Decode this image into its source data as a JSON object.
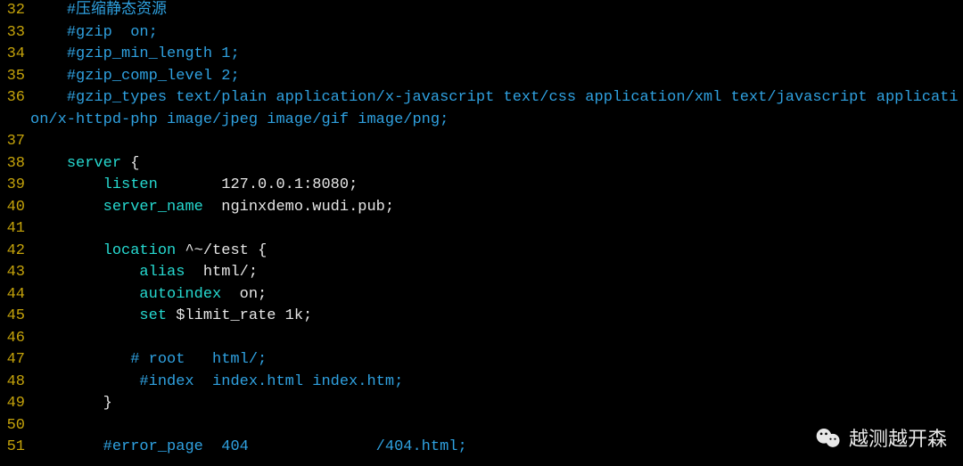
{
  "colors": {
    "bg": "#000000",
    "gutter": "#c5a30a",
    "comment": "#2fa1e0",
    "keyword": "#26d9d0",
    "text": "#e6e6e6"
  },
  "watermark": {
    "text": "越测越开森"
  },
  "lines": [
    {
      "num": 32,
      "indent": "    ",
      "segments": [
        {
          "cls": "c-comment",
          "t": "#压缩静态资源"
        }
      ]
    },
    {
      "num": 33,
      "indent": "    ",
      "segments": [
        {
          "cls": "c-comment",
          "t": "#gzip  on;"
        }
      ]
    },
    {
      "num": 34,
      "indent": "    ",
      "segments": [
        {
          "cls": "c-comment",
          "t": "#gzip_min_length 1;"
        }
      ]
    },
    {
      "num": 35,
      "indent": "    ",
      "segments": [
        {
          "cls": "c-comment",
          "t": "#gzip_comp_level 2;"
        }
      ]
    },
    {
      "num": 36,
      "indent": "    ",
      "segments": [
        {
          "cls": "c-comment",
          "t": "#gzip_types text/plain application/x-javascript text/css application/xml text/javascript application/x-httpd-php image/jpeg image/gif image/png;"
        }
      ]
    },
    {
      "num": 37,
      "indent": "",
      "segments": []
    },
    {
      "num": 38,
      "indent": "    ",
      "segments": [
        {
          "cls": "c-keyword",
          "t": "server"
        },
        {
          "cls": "c-text",
          "t": " {"
        }
      ]
    },
    {
      "num": 39,
      "indent": "        ",
      "segments": [
        {
          "cls": "c-keyword",
          "t": "listen"
        },
        {
          "cls": "c-text",
          "t": "       127.0.0.1:8080;"
        }
      ]
    },
    {
      "num": 40,
      "indent": "        ",
      "segments": [
        {
          "cls": "c-keyword",
          "t": "server_name"
        },
        {
          "cls": "c-text",
          "t": "  nginxdemo.wudi.pub;"
        }
      ]
    },
    {
      "num": 41,
      "indent": "",
      "segments": []
    },
    {
      "num": 42,
      "indent": "        ",
      "segments": [
        {
          "cls": "c-keyword",
          "t": "location"
        },
        {
          "cls": "c-text",
          "t": " ^~/test {"
        }
      ]
    },
    {
      "num": 43,
      "indent": "            ",
      "segments": [
        {
          "cls": "c-keyword",
          "t": "alias"
        },
        {
          "cls": "c-text",
          "t": "  html/;"
        }
      ]
    },
    {
      "num": 44,
      "indent": "            ",
      "segments": [
        {
          "cls": "c-keyword",
          "t": "autoindex"
        },
        {
          "cls": "c-text",
          "t": "  on;"
        }
      ]
    },
    {
      "num": 45,
      "indent": "            ",
      "segments": [
        {
          "cls": "c-keyword",
          "t": "set"
        },
        {
          "cls": "c-text",
          "t": " $limit_rate 1k;"
        }
      ]
    },
    {
      "num": 46,
      "indent": "",
      "segments": []
    },
    {
      "num": 47,
      "indent": "           ",
      "segments": [
        {
          "cls": "c-comment",
          "t": "# root   html/;"
        }
      ]
    },
    {
      "num": 48,
      "indent": "            ",
      "segments": [
        {
          "cls": "c-comment",
          "t": "#index  index.html index.htm;"
        }
      ]
    },
    {
      "num": 49,
      "indent": "        ",
      "segments": [
        {
          "cls": "c-text",
          "t": "}"
        }
      ]
    },
    {
      "num": 50,
      "indent": "",
      "segments": []
    },
    {
      "num": 51,
      "indent": "        ",
      "segments": [
        {
          "cls": "c-comment",
          "t": "#error_page  404              /404.html;"
        }
      ]
    }
  ]
}
